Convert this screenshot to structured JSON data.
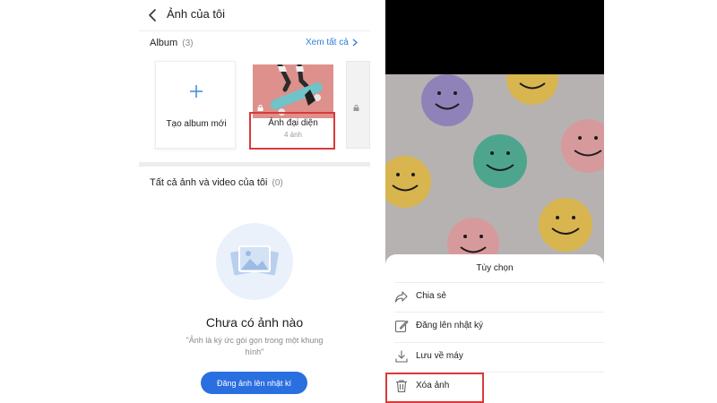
{
  "left": {
    "header": {
      "title": "Ảnh của tôi"
    },
    "album": {
      "label": "Album",
      "count": "(3)",
      "see_all": "Xem tất cả"
    },
    "cards": {
      "new_album": "Tạo album mới",
      "avatar_album": {
        "title": "Ảnh đại diện",
        "count": "4 ảnh"
      }
    },
    "all_media": {
      "label": "Tất cả ảnh và video của tôi",
      "count": "(0)"
    },
    "empty": {
      "title": "Chưa có ảnh nào",
      "subtitle": "\"Ảnh là ký ức gói gọn trong một khung hình\"",
      "button": "Đăng ảnh lên nhật kí"
    }
  },
  "right": {
    "sheet": {
      "title": "Tùy chọn",
      "options": [
        {
          "label": "Chia sẻ",
          "icon": "share-icon"
        },
        {
          "label": "Đăng lên nhật ký",
          "icon": "edit-icon"
        },
        {
          "label": "Lưu về máy",
          "icon": "download-icon"
        },
        {
          "label": "Xóa ảnh",
          "icon": "trash-icon"
        }
      ]
    }
  },
  "colors": {
    "accent": "#2a6fe0",
    "link": "#2f7fd8",
    "highlight": "#d93a3a",
    "photo_background": "#b6b2b1",
    "avatar_thumb": "#dd908c"
  }
}
